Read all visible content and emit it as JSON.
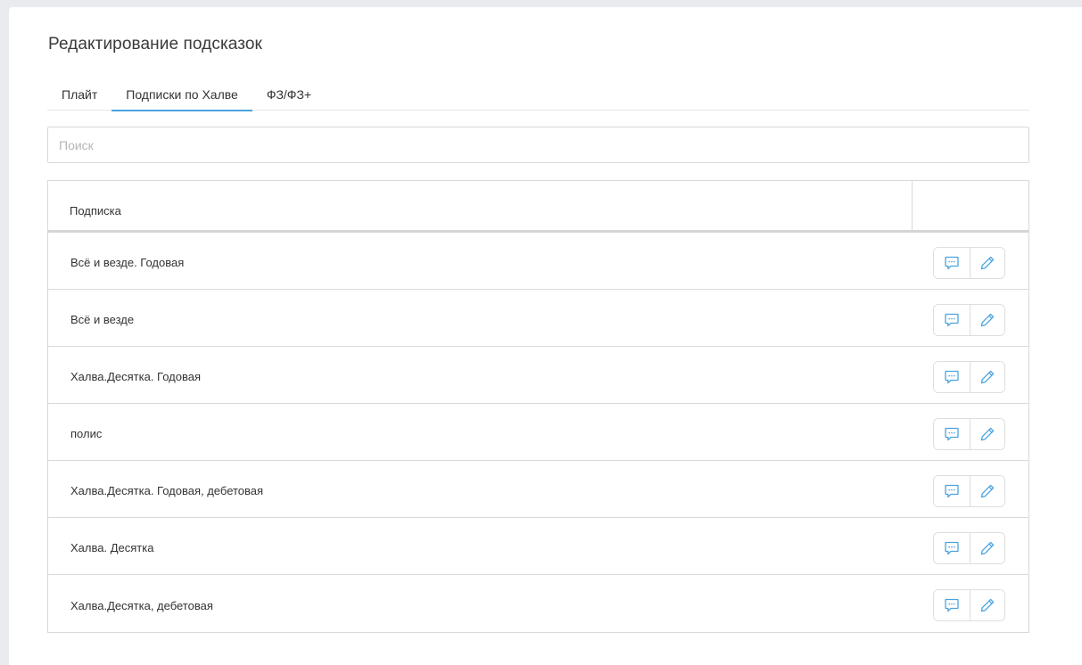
{
  "page": {
    "title": "Редактирование подсказок"
  },
  "tabs": [
    {
      "label": "Плайт",
      "active": false
    },
    {
      "label": "Подписки по Халве",
      "active": true
    },
    {
      "label": "ФЗ/ФЗ+",
      "active": false
    }
  ],
  "search": {
    "placeholder": "Поиск",
    "value": ""
  },
  "table": {
    "columns": [
      "Подписка",
      ""
    ],
    "rows": [
      {
        "name": "Всё и везде. Годовая"
      },
      {
        "name": "Всё и везде"
      },
      {
        "name": "Халва.Десятка. Годовая"
      },
      {
        "name": "полис"
      },
      {
        "name": "Халва.Десятка. Годовая, дебетовая"
      },
      {
        "name": "Халва. Десятка"
      },
      {
        "name": "Халва.Десятка, дебетовая"
      }
    ],
    "row_actions": [
      {
        "icon": "comment-icon"
      },
      {
        "icon": "pencil-icon"
      }
    ]
  },
  "colors": {
    "accent": "#4aa3df",
    "background": "#e9ebef",
    "border": "#d9d9d9"
  }
}
